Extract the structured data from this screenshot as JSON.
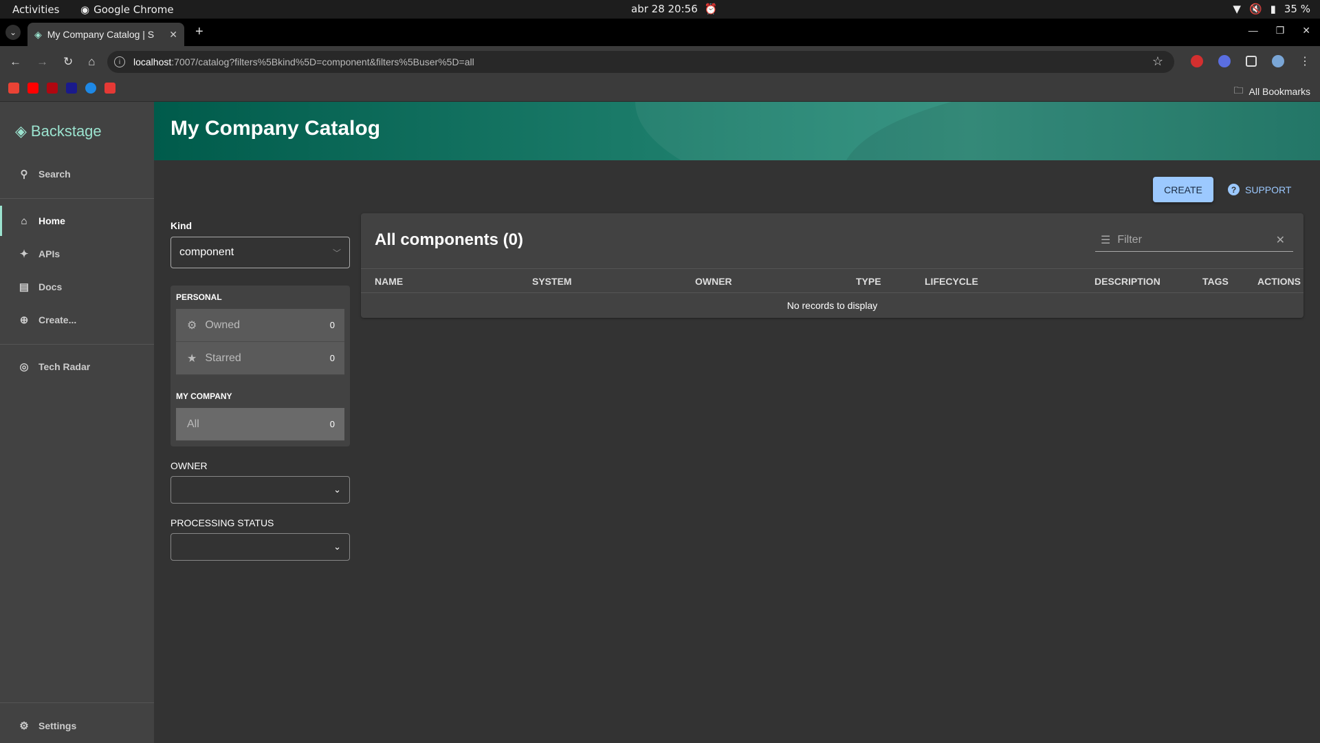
{
  "os": {
    "activities": "Activities",
    "app_name": "Google Chrome",
    "clock": "abr 28  20:56",
    "battery": "35 %"
  },
  "browser": {
    "tab_title": "My Company Catalog | S",
    "url_host": "localhost",
    "url_rest": ":7007/catalog?filters%5Bkind%5D=component&filters%5Buser%5D=all",
    "all_bookmarks": "All Bookmarks"
  },
  "sidebar": {
    "brand": "Backstage",
    "search": "Search",
    "items": [
      {
        "label": "Home",
        "icon": "home-icon"
      },
      {
        "label": "APIs",
        "icon": "puzzle-icon"
      },
      {
        "label": "Docs",
        "icon": "docs-icon"
      },
      {
        "label": "Create...",
        "icon": "add-circle-icon"
      }
    ],
    "tech_radar": "Tech Radar",
    "settings": "Settings"
  },
  "header": {
    "title": "My Company Catalog"
  },
  "actions": {
    "create": "CREATE",
    "support": "SUPPORT"
  },
  "filters": {
    "kind_label": "Kind",
    "kind_value": "component",
    "personal_header": "PERSONAL",
    "owned": {
      "label": "Owned",
      "count": "0"
    },
    "starred": {
      "label": "Starred",
      "count": "0"
    },
    "company_header": "MY COMPANY",
    "all": {
      "label": "All",
      "count": "0"
    },
    "owner_label": "OWNER",
    "processing_label": "PROCESSING STATUS"
  },
  "table": {
    "title": "All components (0)",
    "filter_placeholder": "Filter",
    "columns": [
      "NAME",
      "SYSTEM",
      "OWNER",
      "TYPE",
      "LIFECYCLE",
      "DESCRIPTION",
      "TAGS",
      "ACTIONS"
    ],
    "empty": "No records to display"
  },
  "colors": {
    "accent": "#9be3cf",
    "header": "#005b4b",
    "primary_button": "#9cc9ff"
  }
}
